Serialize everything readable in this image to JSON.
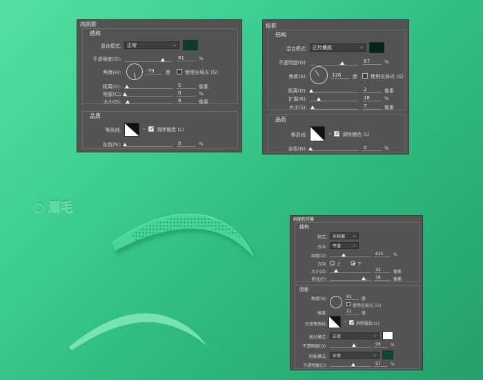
{
  "inner_shadow_panel": {
    "title": "内阴影",
    "structure_title": "结构",
    "blend_mode_label": "混合模式:",
    "blend_mode_value": "正常",
    "swatch_color": "#0d3b2c",
    "opacity_label": "不透明度(O):",
    "opacity_value": "81",
    "opacity_unit": "%",
    "opacity_level": 0.81,
    "angle_label": "角度(A):",
    "angle_value": "-79",
    "angle_unit": "度",
    "global_light_label": "使用全局光 (G)",
    "distance_label": "距离(D):",
    "distance_value": "5",
    "distance_unit": "像素",
    "choke_label": "阻塞(C):",
    "choke_value": "0",
    "choke_unit": "%",
    "size_label": "大小(S):",
    "size_value": "8",
    "size_unit": "像素",
    "quality_title": "品质",
    "contour_label": "等高线:",
    "antialias_label": "消除锯齿 (L)",
    "noise_label": "杂色(N):",
    "noise_value": "0",
    "noise_unit": "%"
  },
  "drop_shadow_panel": {
    "title": "投影",
    "structure_title": "结构",
    "blend_mode_label": "混合模式:",
    "blend_mode_value": "正片叠底",
    "swatch_color": "#062318",
    "opacity_label": "不透明度(O):",
    "opacity_value": "67",
    "opacity_unit": "%",
    "opacity_level": 0.67,
    "angle_label": "角度(A):",
    "angle_value": "126",
    "angle_unit": "度",
    "global_light_label": "使用全局光 (G)",
    "distance_label": "距离(D):",
    "distance_value": "2",
    "distance_unit": "像素",
    "spread_label": "扩展(R):",
    "spread_value": "18",
    "spread_unit": "%",
    "size_label": "大小(S):",
    "size_value": "7",
    "size_unit": "像素",
    "quality_title": "品质",
    "contour_label": "等高线:",
    "antialias_label": "消除锯齿 (L)",
    "noise_label": "杂色(N):",
    "noise_value": "0",
    "noise_unit": "%"
  },
  "heading": {
    "text": "○ 眉毛"
  },
  "bevel_panel": {
    "title": "斜面和浮雕",
    "structure_title": "结构",
    "style_label": "样式:",
    "style_value": "外斜面",
    "technique_label": "方法:",
    "technique_value": "平滑",
    "depth_label": "深度(D):",
    "depth_value": "625",
    "depth_unit": "%",
    "direction_label": "方向:",
    "direction_up": "上",
    "direction_down": "下",
    "size_label": "大小(Z):",
    "size_value": "32",
    "size_unit": "像素",
    "soften_label": "软化(F):",
    "soften_value": "16",
    "soften_unit": "像素",
    "shading_title": "阴影",
    "angle_label": "角度(N):",
    "angle_value": "61",
    "angle_unit": "度",
    "global_light_label": "使用全局光 (G)",
    "altitude_label": "高度:",
    "altitude_value": "21",
    "altitude_unit": "度",
    "gloss_contour_label": "光泽等高线:",
    "antialias_label": "消除锯齿 (L)",
    "highlight_mode_label": "高光模式:",
    "highlight_mode_value": "正常",
    "highlight_color": "#ffffff",
    "highlight_opacity_label": "不透明度(O):",
    "highlight_opacity_value": "59",
    "highlight_opacity_unit": "%",
    "shadow_mode_label": "阴影模式:",
    "shadow_mode_value": "正常",
    "shadow_color": "#0a4a30",
    "shadow_opacity_label": "不透明度(C):",
    "shadow_opacity_value": "57",
    "shadow_opacity_unit": "%"
  }
}
